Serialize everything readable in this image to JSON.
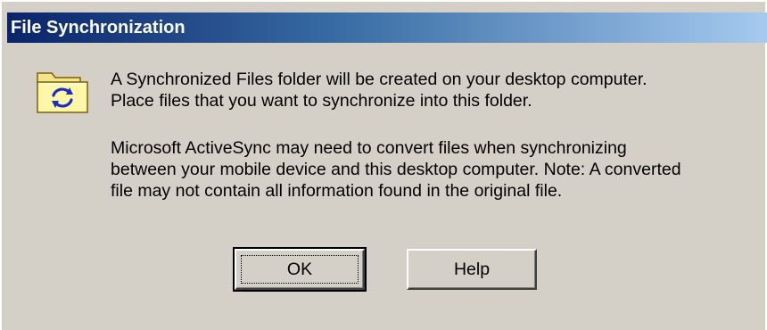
{
  "window": {
    "title": "File Synchronization"
  },
  "message": {
    "line1": "A Synchronized Files folder will be created on your desktop computer.",
    "line2": "Place files that you want to synchronize into this folder.",
    "line3": "Microsoft ActiveSync may need to convert files when synchronizing",
    "line4": "between your mobile device and this desktop computer.  Note: A converted",
    "line5": "file may not contain all information found in the original file."
  },
  "buttons": {
    "ok_label": "OK",
    "help_label": "Help"
  },
  "icon": {
    "name": "sync-folder-icon"
  },
  "colors": {
    "titlebar_start": "#0a246a",
    "titlebar_end": "#a6caf0",
    "dialog_bg": "#d4d0c8"
  }
}
